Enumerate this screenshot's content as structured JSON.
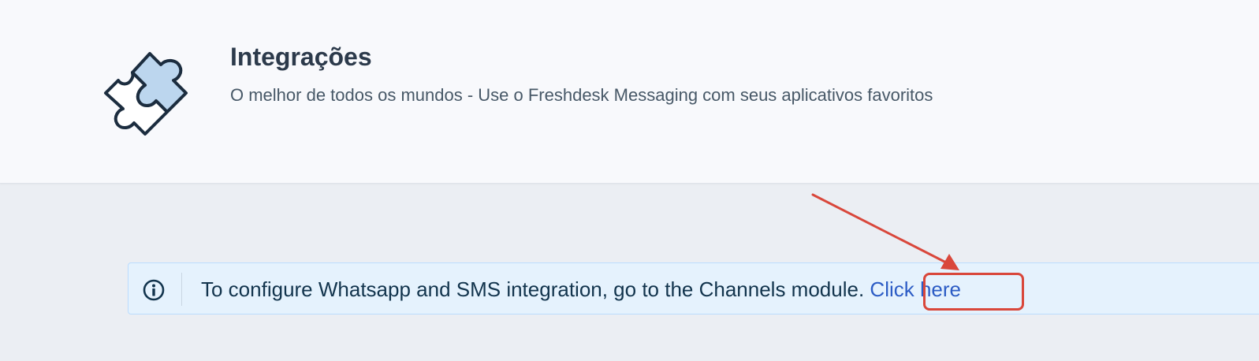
{
  "header": {
    "icon": "puzzle-piece-icon",
    "title": "Integrações",
    "subtitle": "O melhor de todos os mundos - Use o Freshdesk Messaging com seus aplicativos favoritos"
  },
  "banner": {
    "icon": "info-icon",
    "message": "To configure Whatsapp and SMS integration, go to the Channels module.",
    "link_label": "Click here"
  },
  "annotation": {
    "color": "#d9473b"
  },
  "colors": {
    "link": "#2c5cc5",
    "banner_bg": "#e5f2fd",
    "banner_border": "#bbdcfe",
    "page_bg": "#ebeef3"
  }
}
